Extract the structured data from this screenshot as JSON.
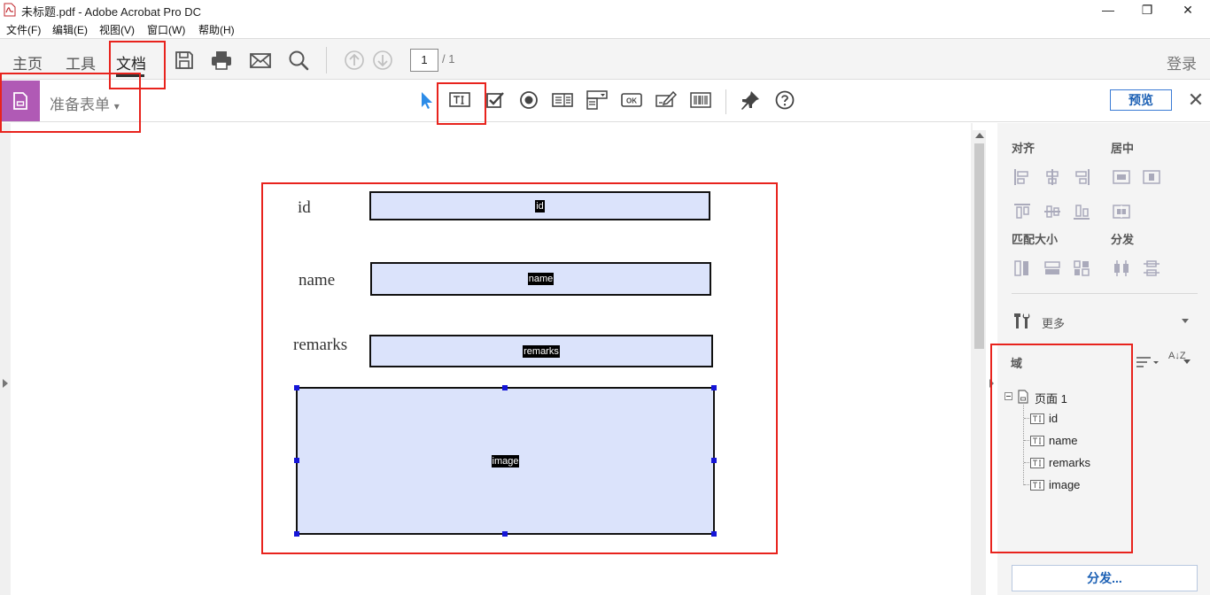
{
  "window": {
    "title": "未标题.pdf - Adobe Acrobat Pro DC",
    "minimize_glyph": "—",
    "restore_glyph": "❐",
    "close_glyph": "✕"
  },
  "menubar": [
    "文件(F)",
    "编辑(E)",
    "视图(V)",
    "窗口(W)",
    "帮助(H)"
  ],
  "nav": {
    "tabs": [
      "主页",
      "工具",
      "文档"
    ],
    "active_tab": "文档",
    "page_current": "1",
    "page_total": "/ 1",
    "login": "登录"
  },
  "toolbar": {
    "tool_name": "准备表单",
    "dropdown_glyph": "▾",
    "preview": "预览",
    "close_glyph": "✕"
  },
  "form": {
    "fields": [
      {
        "label": "id",
        "field_name": "id"
      },
      {
        "label": "name",
        "field_name": "name"
      },
      {
        "label": "remarks",
        "field_name": "remarks"
      },
      {
        "label": "",
        "field_name": "image"
      }
    ]
  },
  "right_panel": {
    "align": "对齐",
    "center": "居中",
    "match_size": "匹配大小",
    "distribute": "分发",
    "more": "更多",
    "fields_header": "域",
    "sort_glyph": "A↓Z",
    "tree_root": "页面 1",
    "tree_items": [
      "id",
      "name",
      "remarks",
      "image"
    ],
    "distribute_button": "分发..."
  },
  "colors": {
    "accent": "#1a5fb4",
    "prepare_form_purple": "#b05ab5",
    "field_fill": "#dbe3fb",
    "annotation_red": "#e8231d",
    "selection_handle": "#1515d8"
  }
}
